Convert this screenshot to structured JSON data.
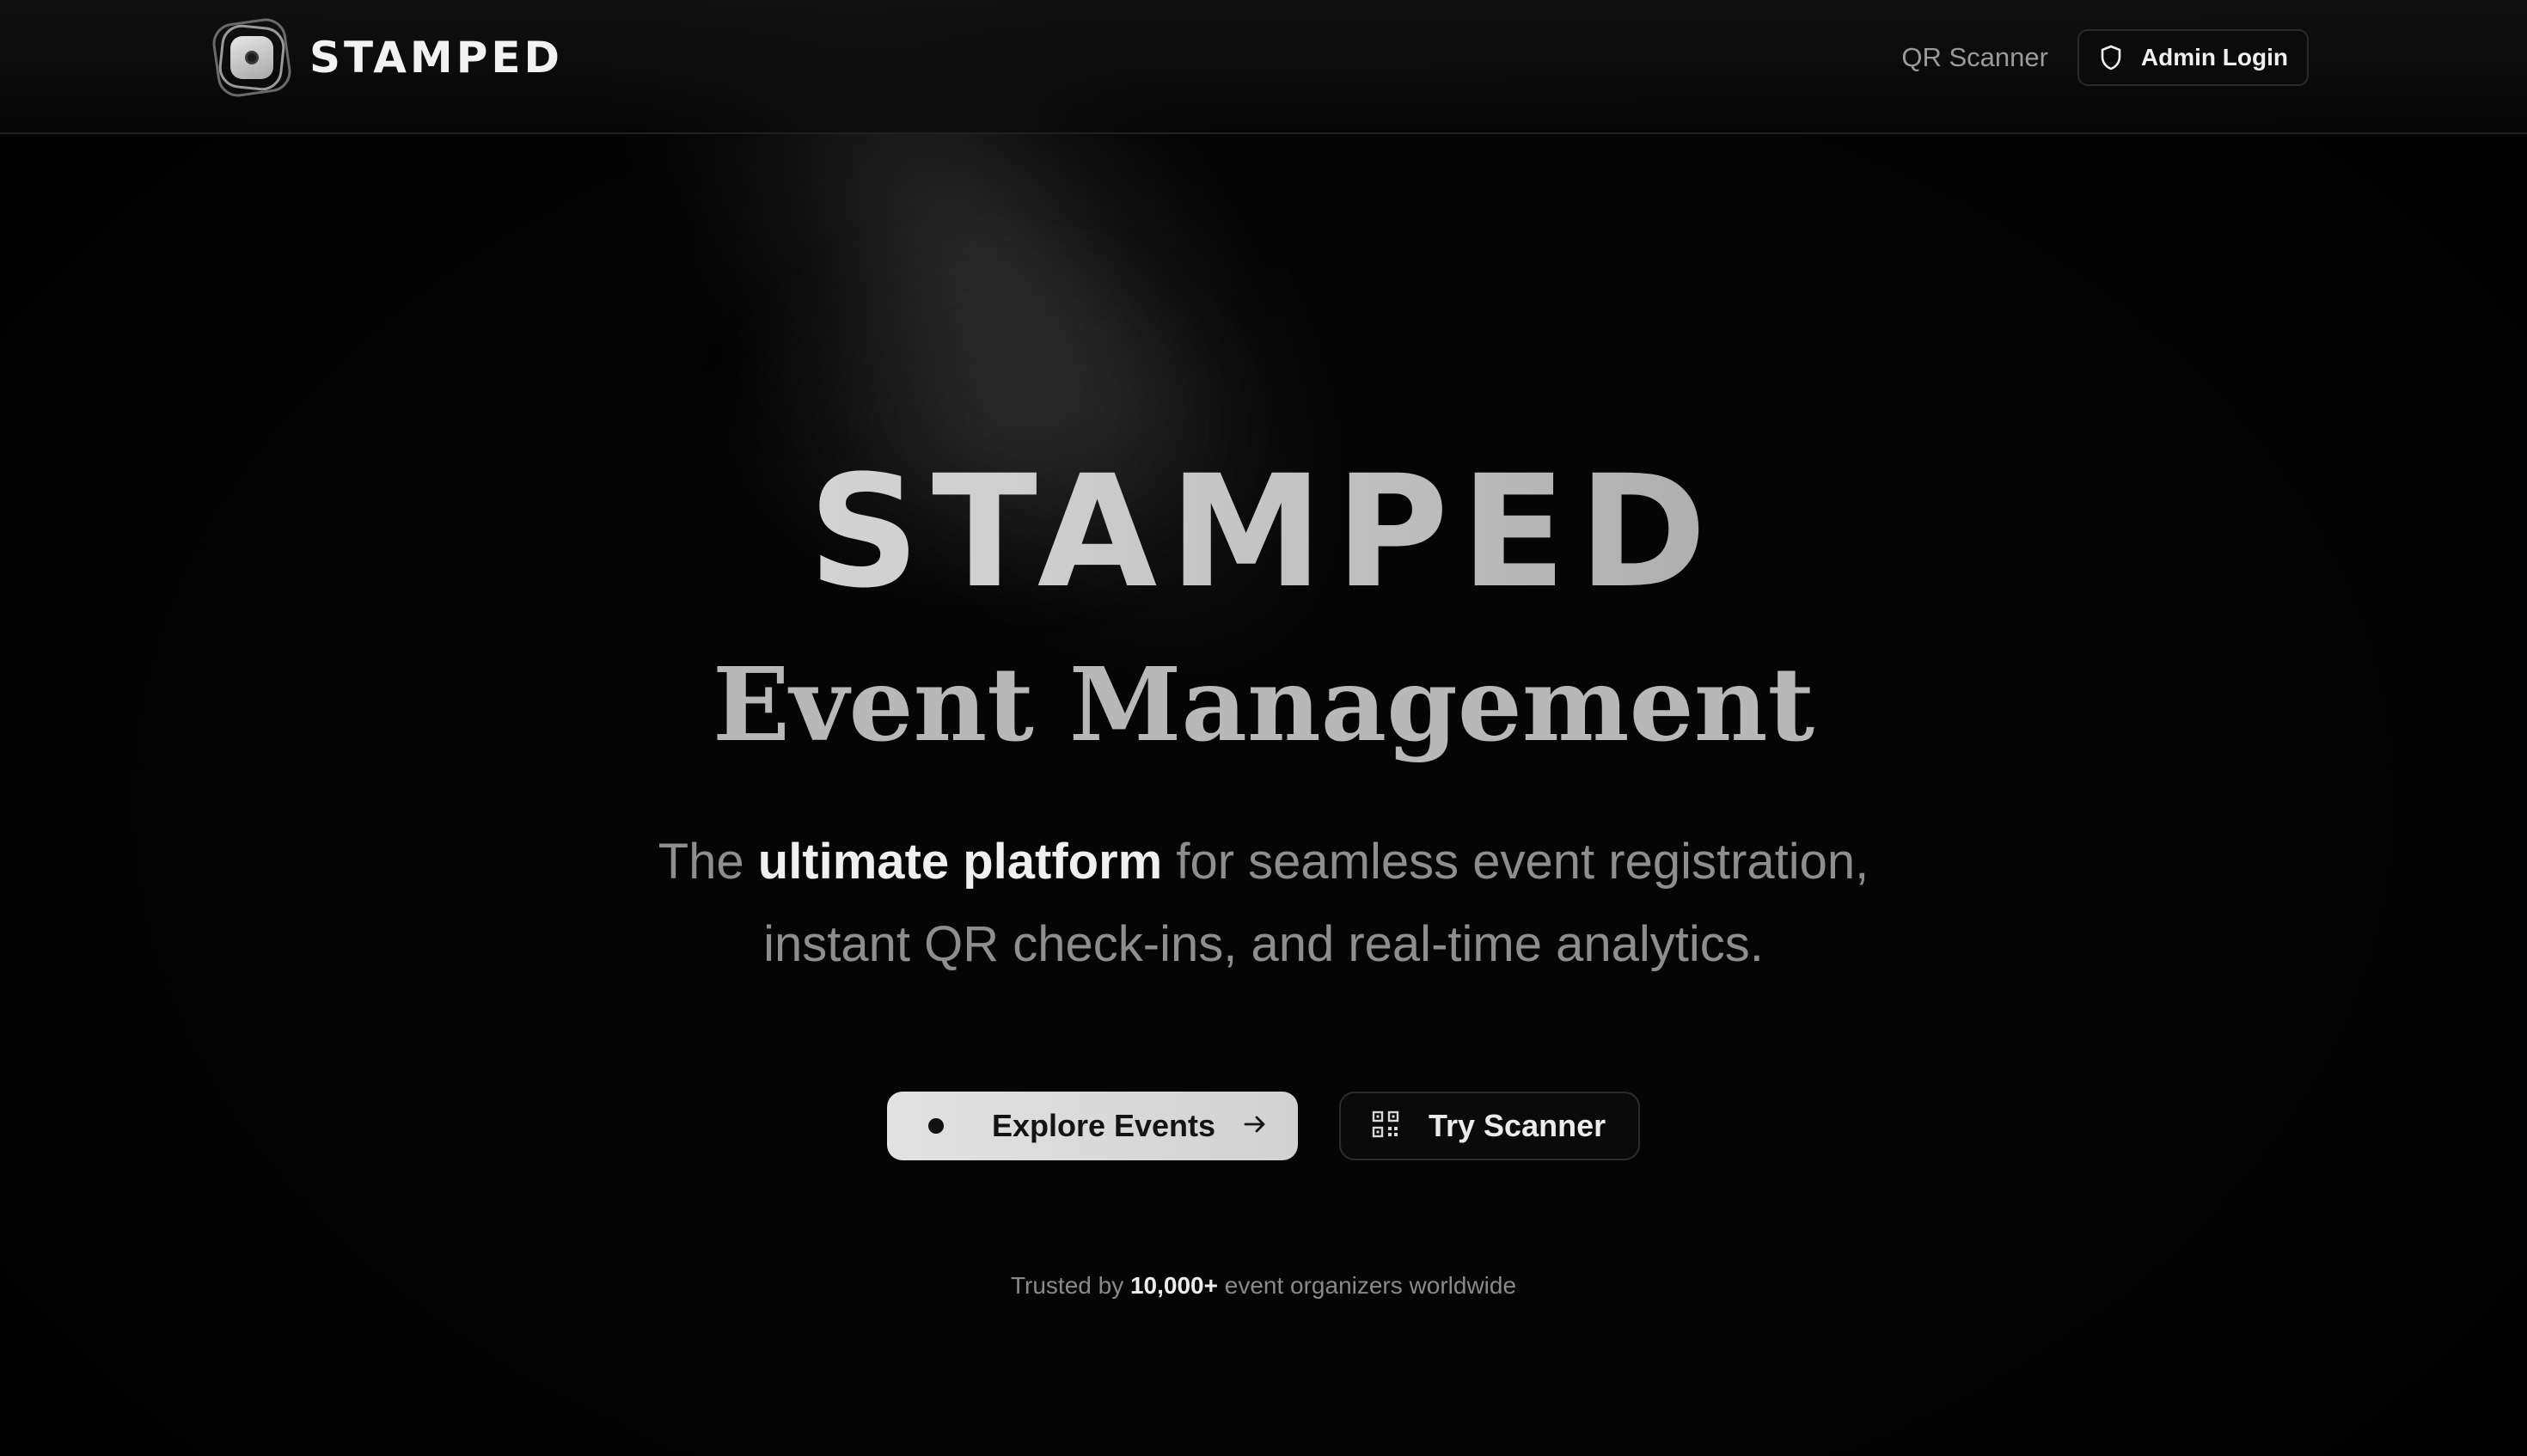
{
  "header": {
    "brand_name": "STAMPED",
    "nav_qr_scanner": "QR Scanner",
    "admin_login": "Admin Login"
  },
  "hero": {
    "title": "STAMPED",
    "subtitle": "Event Management",
    "desc_part1": "The ",
    "desc_bold": "ultimate platform",
    "desc_part2": " for seamless event registration,",
    "desc_line2": "instant QR check-ins, and real-time analytics.",
    "primary_cta": "Explore Events",
    "secondary_cta": "Try Scanner",
    "trusted_prefix": "Trusted by ",
    "trusted_count": "10,000+",
    "trusted_suffix": " event organizers worldwide"
  },
  "icons": {
    "logo": "stamped-logo-icon",
    "admin": "shield-icon",
    "primary_left": "dot-icon",
    "primary_right": "arrow-right-icon",
    "secondary_left": "qr-code-icon"
  },
  "colors": {
    "background": "#050505",
    "primary_button": "#d9d9d9",
    "text_muted": "#8e8e8e"
  }
}
